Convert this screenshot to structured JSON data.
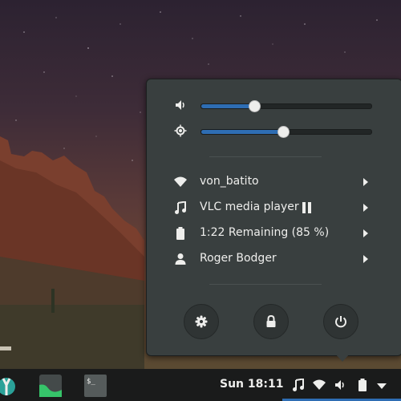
{
  "sliders": {
    "volume": {
      "level": 0.31
    },
    "brightness": {
      "level": 0.48
    }
  },
  "menu": {
    "wifi": {
      "label": "von_batito"
    },
    "media": {
      "label": "VLC media player"
    },
    "battery": {
      "label": "1:22 Remaining (85 %)"
    },
    "user": {
      "label": "Roger Bodger"
    }
  },
  "taskbar": {
    "clock": "Sun 18:11",
    "terminal_glyph": "$_"
  },
  "colors": {
    "accent": "#2e6db3",
    "popup_bg": "#393f3f",
    "panel_bg": "#1a1b1b",
    "text": "#eeeeec"
  },
  "icons": [
    "volume-icon",
    "brightness-icon",
    "wifi-icon",
    "music-note-icon",
    "pause-icon",
    "battery-icon",
    "user-icon",
    "settings-icon",
    "lock-icon",
    "power-icon"
  ]
}
